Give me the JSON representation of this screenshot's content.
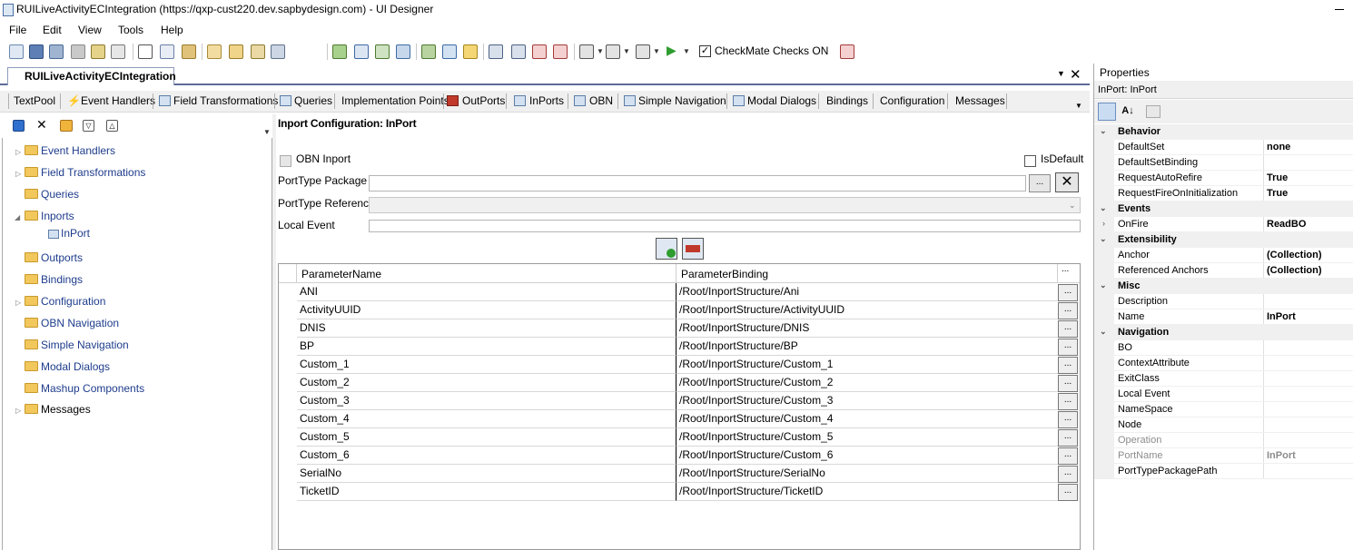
{
  "window": {
    "title": "RUILiveActivityECIntegration (https://qxp-cust220.dev.sapbydesign.com) - UI Designer"
  },
  "menu": {
    "items": [
      "File",
      "Edit",
      "View",
      "Tools",
      "Help"
    ]
  },
  "toolbar": {
    "checkmate_label": "CheckMate Checks ON",
    "checkmate_checked": "✓"
  },
  "document": {
    "tab_label": "RUILiveActivityECIntegration"
  },
  "tabs": [
    "TextPool",
    "Event Handlers",
    "Field Transformations",
    "Queries",
    "Implementation Points",
    "OutPorts",
    "InPorts",
    "OBN",
    "Simple Navigation",
    "Modal Dialogs",
    "Bindings",
    "Configuration",
    "Messages"
  ],
  "tree": {
    "items": [
      "Event Handlers",
      "Field Transformations",
      "Queries",
      "Inports",
      "InPort",
      "Outports",
      "Bindings",
      "Configuration",
      "OBN Navigation",
      "Simple Navigation",
      "Modal Dialogs",
      "Mashup Components",
      "Messages"
    ]
  },
  "config": {
    "heading": "Inport Configuration: InPort",
    "obn_inport_label": "OBN Inport",
    "isdefault_label": "IsDefault",
    "porttype_package_label": "PortType Package",
    "porttype_reference_label": "PortType Reference",
    "local_event_label": "Local Event",
    "browse_label": "...",
    "clear_label": "✕"
  },
  "grid": {
    "columns": [
      "ParameterName",
      "ParameterBinding",
      "..."
    ],
    "rows": [
      {
        "name": "ANI",
        "binding": "/Root/InportStructure/Ani"
      },
      {
        "name": "ActivityUUID",
        "binding": "/Root/InportStructure/ActivityUUID"
      },
      {
        "name": "DNIS",
        "binding": "/Root/InportStructure/DNIS"
      },
      {
        "name": "BP",
        "binding": "/Root/InportStructure/BP"
      },
      {
        "name": "Custom_1",
        "binding": "/Root/InportStructure/Custom_1"
      },
      {
        "name": "Custom_2",
        "binding": "/Root/InportStructure/Custom_2"
      },
      {
        "name": "Custom_3",
        "binding": "/Root/InportStructure/Custom_3"
      },
      {
        "name": "Custom_4",
        "binding": "/Root/InportStructure/Custom_4"
      },
      {
        "name": "Custom_5",
        "binding": "/Root/InportStructure/Custom_5"
      },
      {
        "name": "Custom_6",
        "binding": "/Root/InportStructure/Custom_6"
      },
      {
        "name": "SerialNo",
        "binding": "/Root/InportStructure/SerialNo"
      },
      {
        "name": "TicketID",
        "binding": "/Root/InportStructure/TicketID"
      }
    ],
    "row_button_label": "..."
  },
  "properties": {
    "title": "Properties",
    "object": "InPort: InPort",
    "rows": [
      {
        "type": "cat",
        "name": "Behavior"
      },
      {
        "name": "DefaultSet",
        "value": "none"
      },
      {
        "name": "DefaultSetBinding",
        "value": ""
      },
      {
        "name": "RequestAutoRefire",
        "value": "True"
      },
      {
        "name": "RequestFireOnInitialization",
        "value": "True"
      },
      {
        "type": "cat",
        "name": "Events"
      },
      {
        "name": "OnFire",
        "value": "ReadBO",
        "expand": "›"
      },
      {
        "type": "cat",
        "name": "Extensibility"
      },
      {
        "name": "Anchor",
        "value": "(Collection)"
      },
      {
        "name": "Referenced Anchors",
        "value": "(Collection)"
      },
      {
        "type": "cat",
        "name": "Misc"
      },
      {
        "name": "Description",
        "value": ""
      },
      {
        "name": "Name",
        "value": "InPort"
      },
      {
        "type": "cat",
        "name": "Navigation"
      },
      {
        "name": "BO",
        "value": ""
      },
      {
        "name": "ContextAttribute",
        "value": ""
      },
      {
        "name": "ExitClass",
        "value": ""
      },
      {
        "name": "Local Event",
        "value": ""
      },
      {
        "name": "NameSpace",
        "value": ""
      },
      {
        "name": "Node",
        "value": ""
      },
      {
        "name": "Operation",
        "value": "",
        "disabled": true
      },
      {
        "name": "PortName",
        "value": "InPort",
        "disabled": true
      },
      {
        "name": "PortTypePackagePath",
        "value": ""
      }
    ]
  },
  "colors": {
    "accent": "#5d6b99",
    "link": "#1e3c8c"
  }
}
